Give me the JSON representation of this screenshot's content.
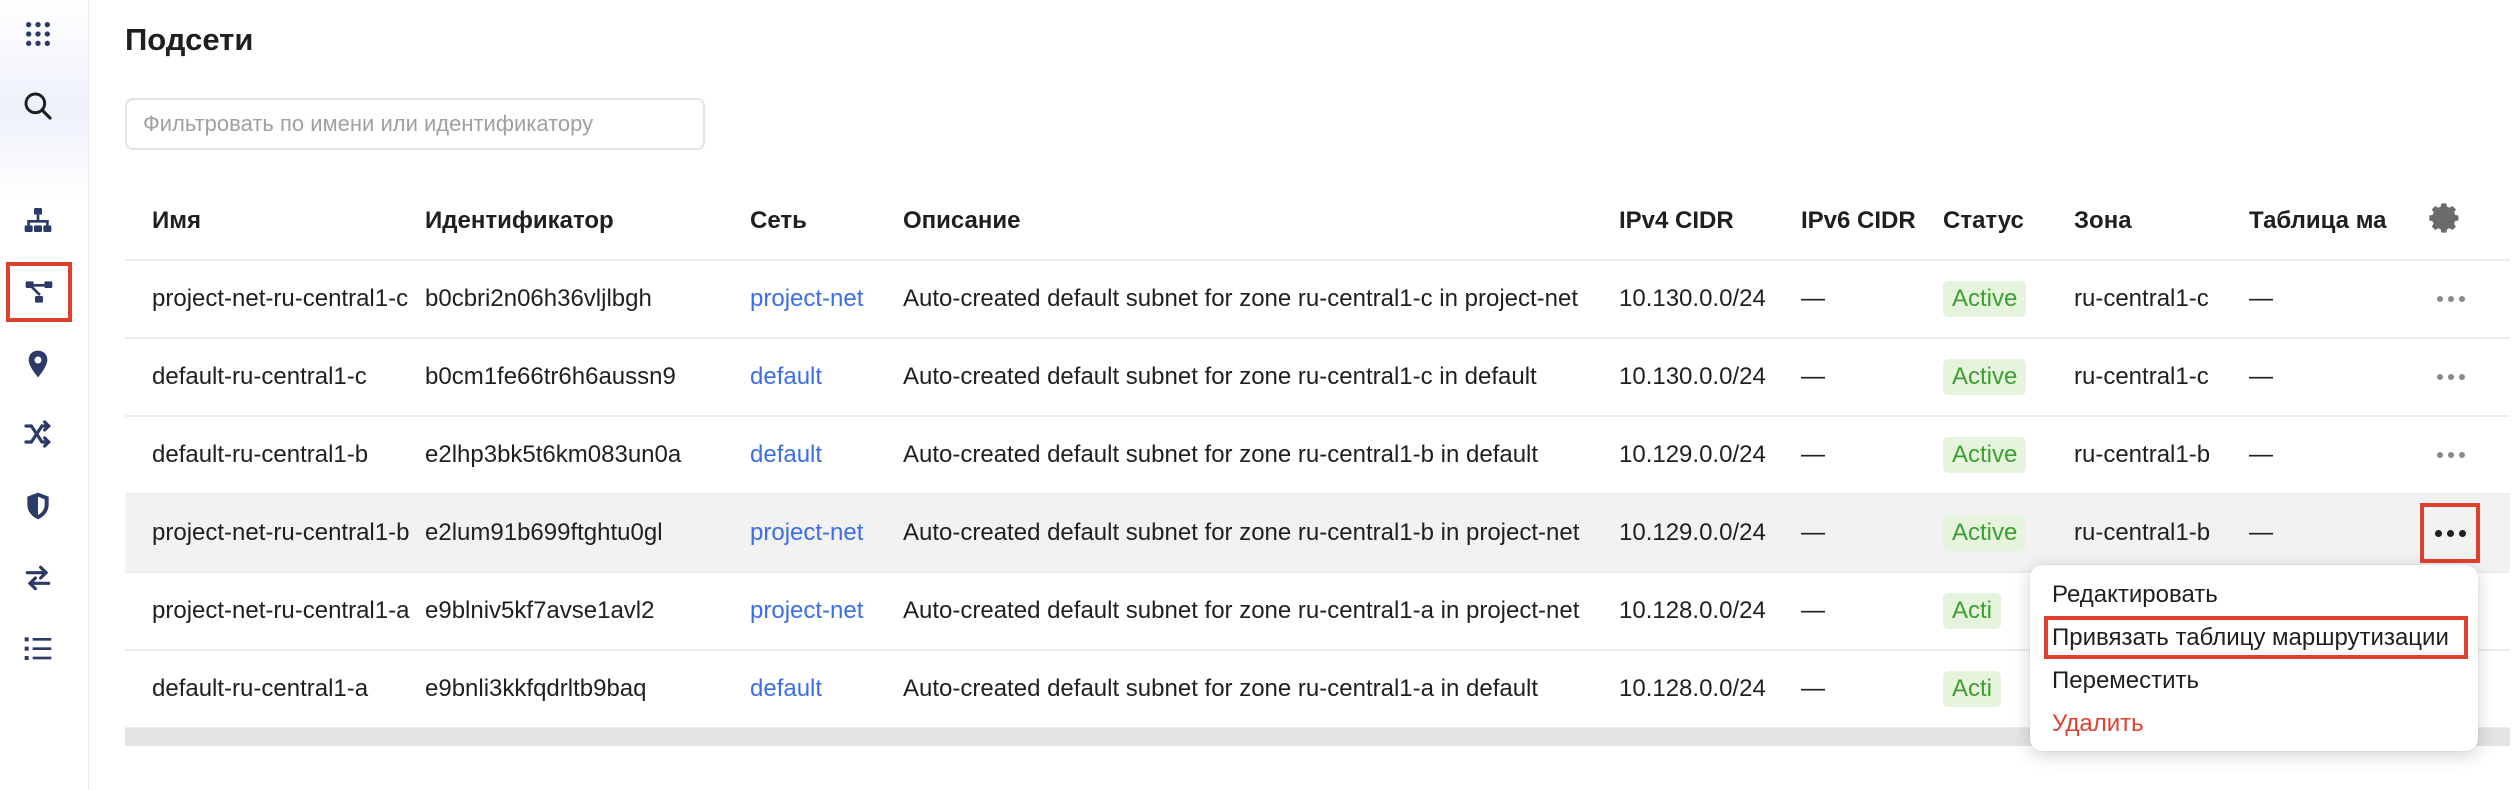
{
  "page": {
    "title": "Подсети"
  },
  "filter": {
    "placeholder": "Фильтровать по имени или идентификатору"
  },
  "sidebar": {
    "icons": [
      "apps-grid-icon",
      "search-icon",
      "network-icon",
      "subnets-icon",
      "location-pin-icon",
      "shuffle-icon",
      "shield-icon",
      "transfer-icon",
      "checklist-icon"
    ],
    "active_icon": "subnets-icon"
  },
  "table": {
    "columns": [
      "Имя",
      "Идентификатор",
      "Сеть",
      "Описание",
      "IPv4 CIDR",
      "IPv6 CIDR",
      "Статус",
      "Зона",
      "Таблица ма"
    ],
    "rows": [
      {
        "name": "project-net-ru-central1-c",
        "id": "b0cbri2n06h36vljlbgh",
        "network": "project-net",
        "description": "Auto-created default subnet for zone ru-central1-c in project-net",
        "ipv4": "10.130.0.0/24",
        "ipv6": "—",
        "status": "Active",
        "zone": "ru-central1-c",
        "route_table": "—"
      },
      {
        "name": "default-ru-central1-c",
        "id": "b0cm1fe66tr6h6aussn9",
        "network": "default",
        "description": "Auto-created default subnet for zone ru-central1-c in default",
        "ipv4": "10.130.0.0/24",
        "ipv6": "—",
        "status": "Active",
        "zone": "ru-central1-c",
        "route_table": "—"
      },
      {
        "name": "default-ru-central1-b",
        "id": "e2lhp3bk5t6km083un0a",
        "network": "default",
        "description": "Auto-created default subnet for zone ru-central1-b in default",
        "ipv4": "10.129.0.0/24",
        "ipv6": "—",
        "status": "Active",
        "zone": "ru-central1-b",
        "route_table": "—"
      },
      {
        "name": "project-net-ru-central1-b",
        "id": "e2lum91b699ftghtu0gl",
        "network": "project-net",
        "description": "Auto-created default subnet for zone ru-central1-b in project-net",
        "ipv4": "10.129.0.0/24",
        "ipv6": "—",
        "status": "Active",
        "zone": "ru-central1-b",
        "route_table": "—"
      },
      {
        "name": "project-net-ru-central1-a",
        "id": "e9blniv5kf7avse1avl2",
        "network": "project-net",
        "description": "Auto-created default subnet for zone ru-central1-a in project-net",
        "ipv4": "10.128.0.0/24",
        "ipv6": "—",
        "status": "Acti",
        "zone": "",
        "route_table": ""
      },
      {
        "name": "default-ru-central1-a",
        "id": "e9bnli3kkfqdrltb9baq",
        "network": "default",
        "description": "Auto-created default subnet for zone ru-central1-a in default",
        "ipv4": "10.128.0.0/24",
        "ipv6": "—",
        "status": "Acti",
        "zone": "",
        "route_table": ""
      }
    ]
  },
  "context_menu": {
    "items": [
      "Редактировать",
      "Привязать таблицу маршрутизации",
      "Переместить",
      "Удалить"
    ]
  },
  "colors": {
    "accent": "#3b6ee8",
    "active_badge_bg": "#e6f4dd",
    "active_badge_text": "#3c9f31",
    "danger": "#e0412e",
    "highlight": "#e0412e"
  }
}
